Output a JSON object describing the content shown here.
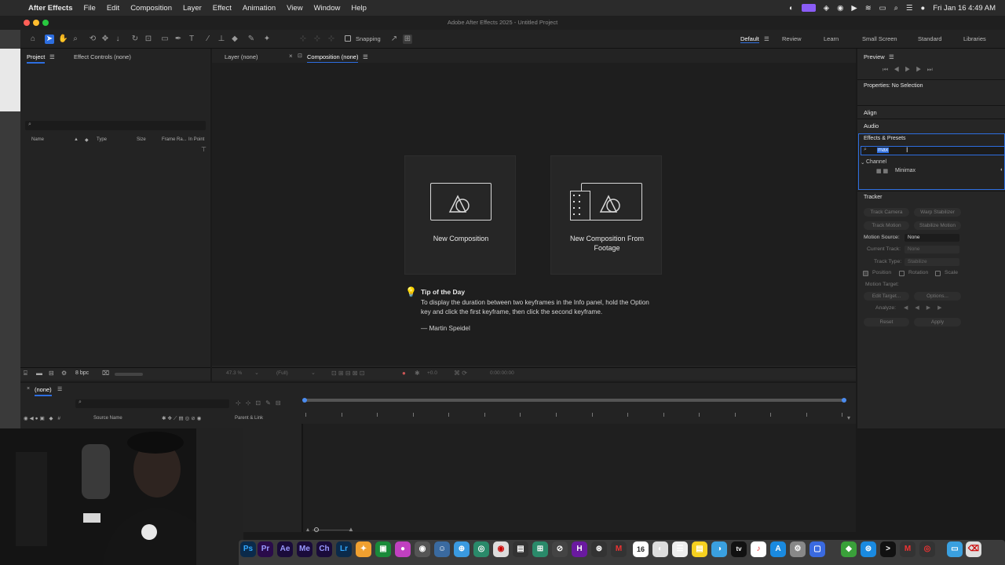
{
  "menubar": {
    "app_name": "After Effects",
    "items": [
      "File",
      "Edit",
      "Composition",
      "Layer",
      "Effect",
      "Animation",
      "View",
      "Window",
      "Help"
    ],
    "clock": "Fri Jan 16  4:49 AM"
  },
  "window": {
    "title": "Adobe After Effects 2025 - Untitled Project"
  },
  "toolbar": {
    "snapping_label": "Snapping",
    "workspaces": [
      "Default",
      "Review",
      "Learn",
      "Small Screen",
      "Standard",
      "Libraries"
    ],
    "active_workspace": "Default"
  },
  "project_panel": {
    "tabs": [
      "Project",
      "Effect Controls (none)"
    ],
    "search_placeholder": "",
    "columns": [
      "Name",
      "Type",
      "Size",
      "Frame Ra...",
      "In Point"
    ],
    "bpc_label": "8 bpc"
  },
  "viewer": {
    "tabs": [
      "Layer (none)",
      "Composition (none)"
    ],
    "cards": [
      {
        "label": "New Composition"
      },
      {
        "label": "New Composition From Footage"
      }
    ],
    "tip": {
      "title": "Tip of the Day",
      "body": "To display the duration between two keyframes in the Info panel, hold the Option key and click the first keyframe, then click the second keyframe.",
      "author": "— Martin Speidel"
    },
    "footer": {
      "zoom": "47.3 %",
      "resolution": "(Full)",
      "exposure": "+0.0",
      "timecode": "0:00:00:00"
    }
  },
  "right_panel": {
    "preview_label": "Preview",
    "properties_label": "Properties: No Selection",
    "align_label": "Align",
    "audio_label": "Audio",
    "effects_presets": {
      "label": "Effects & Presets",
      "search_value": "max",
      "tree": {
        "category": "Channel",
        "item": "Minimax"
      }
    },
    "tracker": {
      "label": "Tracker",
      "buttons_row1": [
        "Track Camera",
        "Warp Stabilizer"
      ],
      "buttons_row2": [
        "Track Motion",
        "Stabilize Motion"
      ],
      "motion_source_label": "Motion Source:",
      "motion_source_value": "None",
      "current_track_label": "Current Track:",
      "current_track_value": "None",
      "track_type_label": "Track Type:",
      "track_type_value": "Stabilize",
      "checks": [
        "Position",
        "Rotation",
        "Scale"
      ],
      "motion_target_label": "Motion Target:",
      "edit_target": "Edit Target...",
      "options": "Options...",
      "analyze_label": "Analyze:",
      "reset": "Reset",
      "apply": "Apply"
    }
  },
  "timeline": {
    "tab": "(none)",
    "col_source": "Source Name",
    "col_parent": "Parent & Link"
  },
  "dock": {
    "apps": [
      "Ps",
      "Pr",
      "Ae",
      "Me",
      "Ch",
      "Lr"
    ],
    "calendar_day": "16"
  },
  "colors": {
    "accent": "#2d6ee0",
    "panel": "#232323",
    "selection": "#2d6ee0"
  }
}
